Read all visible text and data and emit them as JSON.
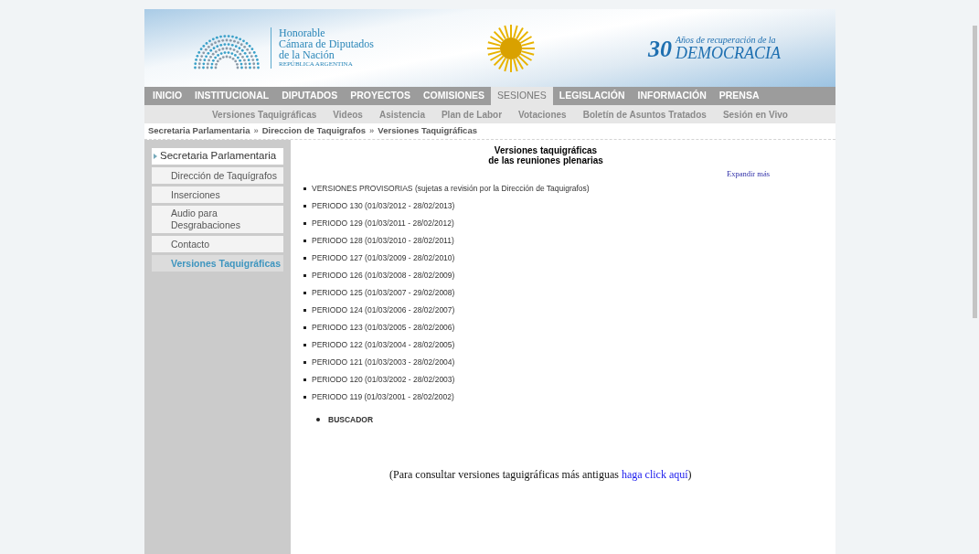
{
  "header": {
    "org_lines": [
      "Honorable",
      "Cámara de Diputados",
      "de la Nación"
    ],
    "org_subtitle": "REPÚBLICA ARGENTINA",
    "anniversary_number": "30",
    "anniversary_caption": "Años de recuperación de la",
    "anniversary_word": "DEMOCRACIA"
  },
  "nav": [
    {
      "label": "INICIO",
      "selected": false
    },
    {
      "label": "INSTITUCIONAL",
      "selected": false
    },
    {
      "label": "DIPUTADOS",
      "selected": false
    },
    {
      "label": "PROYECTOS",
      "selected": false
    },
    {
      "label": "COMISIONES",
      "selected": false
    },
    {
      "label": "SESIONES",
      "selected": true
    },
    {
      "label": "LEGISLACIÓN",
      "selected": false
    },
    {
      "label": "INFORMACIÓN",
      "selected": false
    },
    {
      "label": "PRENSA",
      "selected": false
    }
  ],
  "subnav": [
    "Versiones Taquigráficas",
    "Videos",
    "Asistencia",
    "Plan de Labor",
    "Votaciones",
    "Boletín de Asuntos Tratados",
    "Sesión en Vivo"
  ],
  "breadcrumb": [
    "Secretaria Parlamentaria",
    "Direccion de Taquigrafos",
    "Versiones Taquigráficas"
  ],
  "breadcrumb_separator": "»",
  "sidebar": {
    "title": "Secretaria Parlamentaria",
    "items": [
      {
        "label": "Dirección de Taquígrafos",
        "selected": false
      },
      {
        "label": "Inserciones",
        "selected": false
      },
      {
        "label": "Audio para Desgrabaciones",
        "selected": false
      },
      {
        "label": "Contacto",
        "selected": false
      },
      {
        "label": "Versiones Taquigráficas",
        "selected": true
      }
    ]
  },
  "content": {
    "title_lines": [
      "Versiones taquigráficas",
      "de las reuniones plenarias"
    ],
    "expand_link": "Expandir más",
    "periods": [
      "VERSIONES PROVISORIAS (sujetas a revisión por la Dirección de Taquigrafos)",
      "PERIODO 130 (01/03/2012 - 28/02/2013)",
      "PERIODO 129 (01/03/2011 - 28/02/2012)",
      "PERIODO 128 (01/03/2010 - 28/02/2011)",
      "PERIODO 127 (01/03/2009 - 28/02/2010)",
      "PERIODO 126 (01/03/2008 - 28/02/2009)",
      "PERIODO 125 (01/03/2007 - 29/02/2008)",
      "PERIODO 124 (01/03/2006 - 28/02/2007)",
      "PERIODO 123 (01/03/2005 - 28/02/2006)",
      "PERIODO 122 (01/03/2004 - 28/02/2005)",
      "PERIODO 121 (01/03/2003 - 28/02/2004)",
      "PERIODO 120 (01/03/2002 - 28/02/2003)",
      "PERIODO 119 (01/03/2001 - 28/02/2002)"
    ],
    "search_link": "BUSCADOR",
    "note_text": "(Para consultar versiones taguigráficas más antiguas",
    "note_link": "haga click aquí",
    "note_end": ")"
  }
}
